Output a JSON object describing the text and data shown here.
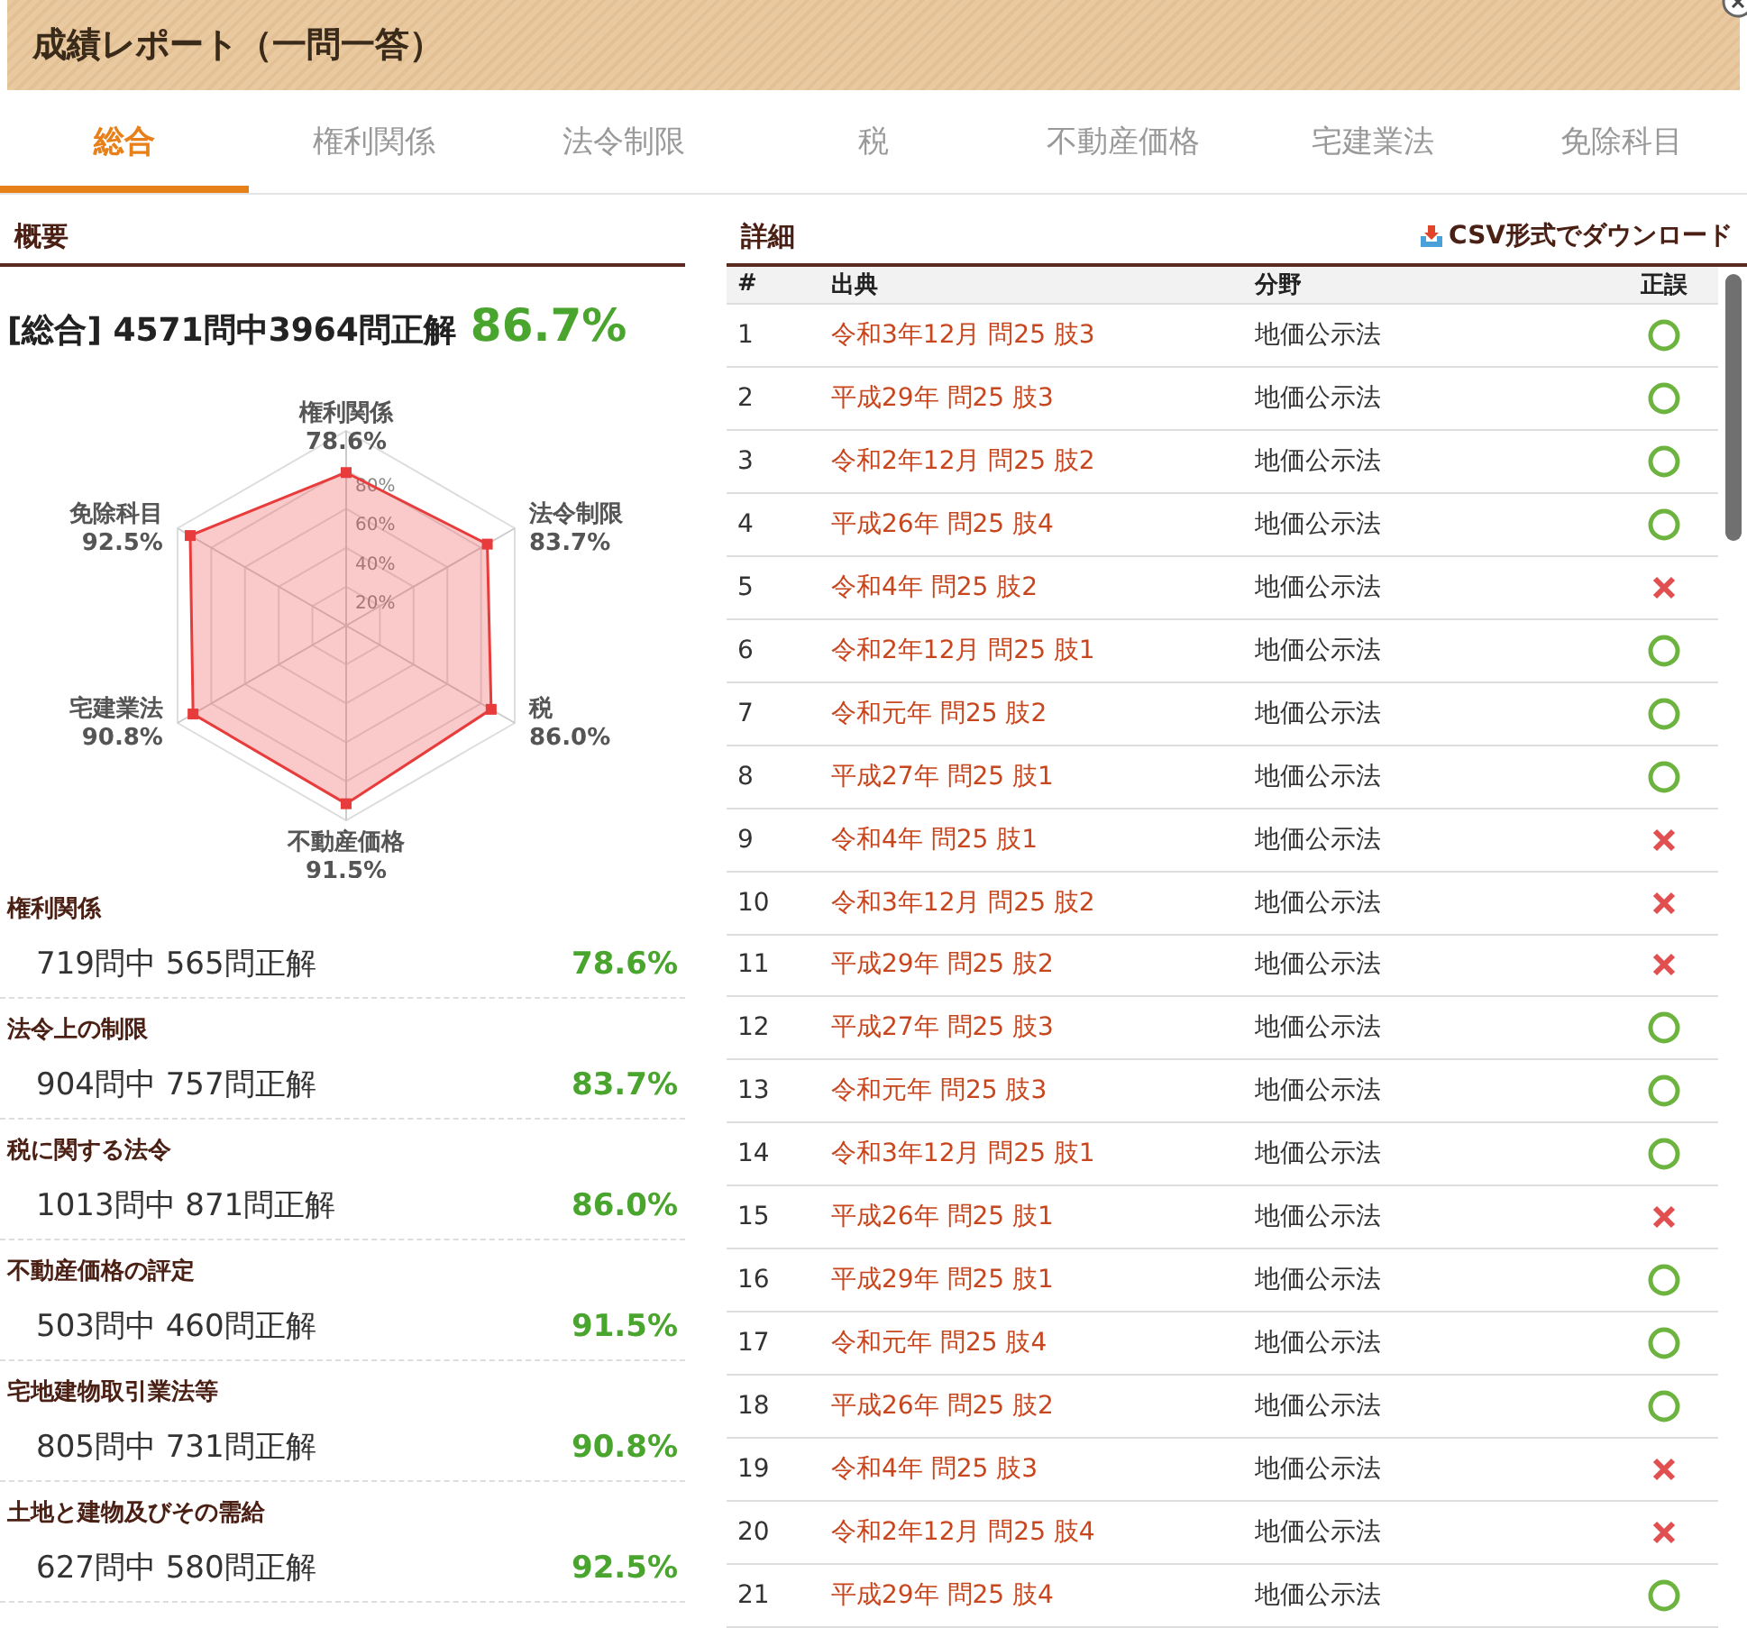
{
  "window": {
    "title": "成績レポート（一問一答）"
  },
  "tabs": [
    {
      "label": "総合",
      "selected": true
    },
    {
      "label": "権利関係",
      "selected": false
    },
    {
      "label": "法令制限",
      "selected": false
    },
    {
      "label": "税",
      "selected": false
    },
    {
      "label": "不動産価格",
      "selected": false
    },
    {
      "label": "宅建業法",
      "selected": false
    },
    {
      "label": "免除科目",
      "selected": false
    }
  ],
  "summary": {
    "heading": "概要",
    "total_label": "[総合] 4571問中3964問正解",
    "total_rate": "86.7%",
    "chart_data": {
      "type": "radar",
      "categories": [
        "権利関係",
        "法令制限",
        "税",
        "不動産価格",
        "宅建業法",
        "免除科目"
      ],
      "series": [
        {
          "color": "#e83b3b",
          "values": [
            78.6,
            83.7,
            86.0,
            91.5,
            90.8,
            92.5
          ]
        }
      ],
      "ylim": [
        0,
        100
      ],
      "yticks": [
        {
          "value": 20,
          "label": "20%"
        },
        {
          "value": 40,
          "label": "40%"
        },
        {
          "value": 60,
          "label": "60%"
        },
        {
          "value": 80,
          "label": "80%"
        }
      ],
      "value_labels": [
        "78.6%",
        "83.7%",
        "86.0%",
        "91.5%",
        "90.8%",
        "92.5%"
      ]
    },
    "categories": [
      {
        "name": "権利関係",
        "stat": "719問中 565問正解",
        "rate": "78.6%"
      },
      {
        "name": "法令上の制限",
        "stat": "904問中 757問正解",
        "rate": "83.7%"
      },
      {
        "name": "税に関する法令",
        "stat": "1013問中 871問正解",
        "rate": "86.0%"
      },
      {
        "name": "不動産価格の評定",
        "stat": "503問中 460問正解",
        "rate": "91.5%"
      },
      {
        "name": "宅地建物取引業法等",
        "stat": "805問中 731問正解",
        "rate": "90.8%"
      },
      {
        "name": "土地と建物及びその需給",
        "stat": "627問中 580問正解",
        "rate": "92.5%"
      }
    ]
  },
  "detail": {
    "heading": "詳細",
    "download": "CSV形式でダウンロード",
    "columns": [
      "#",
      "出典",
      "分野",
      "正誤"
    ],
    "rows": [
      {
        "num": "1",
        "source": "令和3年12月 問25 肢3",
        "field": "地価公示法",
        "correct": true
      },
      {
        "num": "2",
        "source": "平成29年 問25 肢3",
        "field": "地価公示法",
        "correct": true
      },
      {
        "num": "3",
        "source": "令和2年12月 問25 肢2",
        "field": "地価公示法",
        "correct": true
      },
      {
        "num": "4",
        "source": "平成26年 問25 肢4",
        "field": "地価公示法",
        "correct": true
      },
      {
        "num": "5",
        "source": "令和4年 問25 肢2",
        "field": "地価公示法",
        "correct": false
      },
      {
        "num": "6",
        "source": "令和2年12月 問25 肢1",
        "field": "地価公示法",
        "correct": true
      },
      {
        "num": "7",
        "source": "令和元年 問25 肢2",
        "field": "地価公示法",
        "correct": true
      },
      {
        "num": "8",
        "source": "平成27年 問25 肢1",
        "field": "地価公示法",
        "correct": true
      },
      {
        "num": "9",
        "source": "令和4年 問25 肢1",
        "field": "地価公示法",
        "correct": false
      },
      {
        "num": "10",
        "source": "令和3年12月 問25 肢2",
        "field": "地価公示法",
        "correct": false
      },
      {
        "num": "11",
        "source": "平成29年 問25 肢2",
        "field": "地価公示法",
        "correct": false
      },
      {
        "num": "12",
        "source": "平成27年 問25 肢3",
        "field": "地価公示法",
        "correct": true
      },
      {
        "num": "13",
        "source": "令和元年 問25 肢3",
        "field": "地価公示法",
        "correct": true
      },
      {
        "num": "14",
        "source": "令和3年12月 問25 肢1",
        "field": "地価公示法",
        "correct": true
      },
      {
        "num": "15",
        "source": "平成26年 問25 肢1",
        "field": "地価公示法",
        "correct": false
      },
      {
        "num": "16",
        "source": "平成29年 問25 肢1",
        "field": "地価公示法",
        "correct": true
      },
      {
        "num": "17",
        "source": "令和元年 問25 肢4",
        "field": "地価公示法",
        "correct": true
      },
      {
        "num": "18",
        "source": "平成26年 問25 肢2",
        "field": "地価公示法",
        "correct": true
      },
      {
        "num": "19",
        "source": "令和4年 問25 肢3",
        "field": "地価公示法",
        "correct": false
      },
      {
        "num": "20",
        "source": "令和2年12月 問25 肢4",
        "field": "地価公示法",
        "correct": false
      },
      {
        "num": "21",
        "source": "平成29年 問25 肢4",
        "field": "地価公示法",
        "correct": true
      }
    ]
  }
}
